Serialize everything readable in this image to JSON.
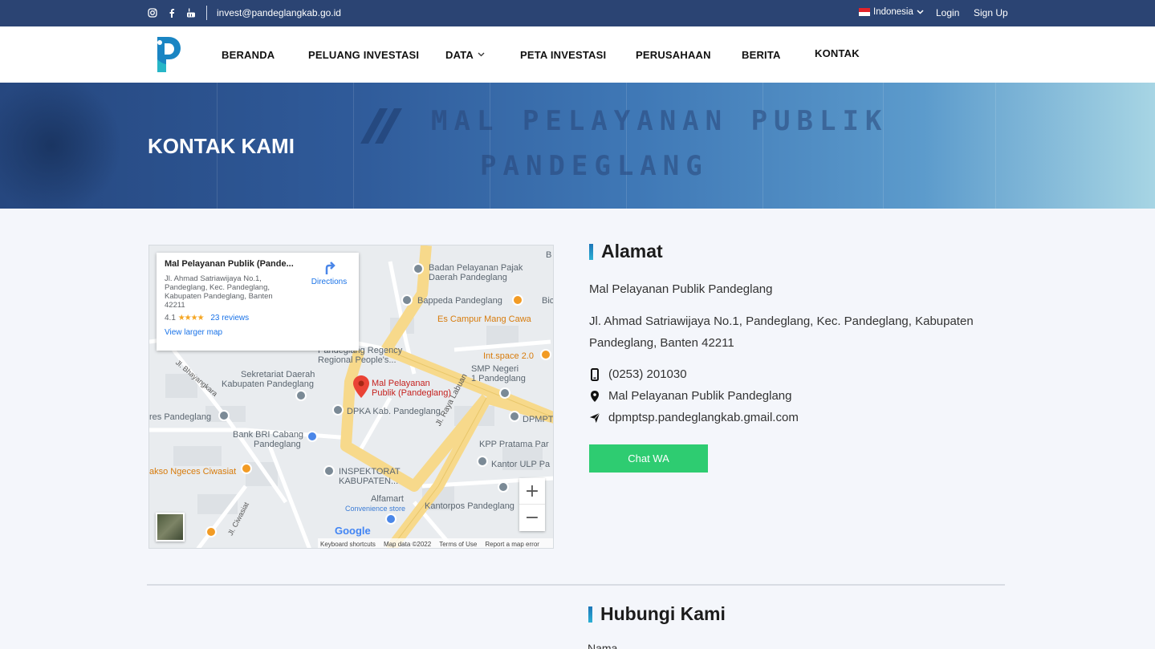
{
  "topbar": {
    "social_icons": [
      "instagram-icon",
      "facebook-icon",
      "youtube-icon"
    ],
    "email": "invest@pandeglangkab.go.id",
    "language": "Indonesia",
    "login": "Login",
    "signup": "Sign Up"
  },
  "nav": {
    "items": [
      {
        "label": "BERANDA"
      },
      {
        "label": "PELUANG INVESTASI"
      },
      {
        "label": "DATA"
      },
      {
        "label": "PETA INVESTASI"
      },
      {
        "label": "PERUSAHAAN"
      },
      {
        "label": "BERITA"
      },
      {
        "label": "KONTAK"
      }
    ]
  },
  "hero": {
    "title": "KONTAK KAMI",
    "sign_line1": "MAL PELAYANAN PUBLIK",
    "sign_line2": "PANDEGLANG"
  },
  "map": {
    "info_title": "Mal Pelayanan Publik (Pande...",
    "info_address": "Jl. Ahmad Satriawijaya No.1, Pandeglang, Kec. Pandeglang, Kabupaten Pandeglang, Banten 42211",
    "rating": "4.1",
    "stars": "★★★★",
    "reviews": "23 reviews",
    "directions": "Directions",
    "view_larger": "View larger map",
    "places": {
      "p1": "Badan Pelayanan Pajak",
      "p1b": "Daerah Pandeglang",
      "p2": "Bappeda Pandeglang",
      "p3": "Es Campur Mang Cawa",
      "p4": "Pandeglang Regency",
      "p4b": "Regional People's...",
      "p5": "Int.space 2.0",
      "p6": "SMP Negeri",
      "p6b": "1 Pandeglang",
      "p7": "Sekretariat Daerah",
      "p7b": "Kabupaten Pandeglang",
      "p8": "Mal Pelayanan",
      "p8b": "Publik (Pandeglang)",
      "p9": "DPKA Kab. Pandeglang",
      "p10": "DPMPT",
      "p11": "res Pandeglang",
      "p12": "Bank BRI Cabang",
      "p12b": "Pandeglang",
      "p13": "KPP Pratama Par",
      "p14": "Kantor ULP Pa",
      "p15": "akso Ngeces Ciwasiat",
      "p16": "INSPEKTORAT",
      "p16b": "KABUPATEN...",
      "p17": "Alfamart",
      "p17b": "Convenience store",
      "p18": "Kantorpos Pandeglang",
      "p19": "Bic",
      "r1": "Jl. Raya Labuan",
      "r2": "Jl. Bhayangkara",
      "r3": "Jl. Ciwasiat"
    },
    "google": "Google",
    "attr": [
      "Keyboard shortcuts",
      "Map data ©2022",
      "Terms of Use",
      "Report a map error"
    ],
    "zoom_in": "+",
    "zoom_out": "−"
  },
  "address": {
    "heading": "Alamat",
    "name": "Mal Pelayanan Publik Pandeglang",
    "line1": "Jl. Ahmad Satriawijaya No.1, Pandeglang, Kec. Pandeglang, Kabupaten",
    "line2": "Pandeglang, Banten 42211",
    "phone": "(0253) 201030",
    "location": "Mal Pelayanan Publik Pandeglang",
    "email": "dpmptsp.pandeglangkab.gmail.com",
    "wa_button": "Chat WA"
  },
  "contact": {
    "heading": "Hubungi Kami",
    "name_label": "Nama"
  },
  "colors": {
    "topbar": "#2b4473",
    "accent": "#2bb0d4",
    "wa_green": "#2ecc71"
  }
}
